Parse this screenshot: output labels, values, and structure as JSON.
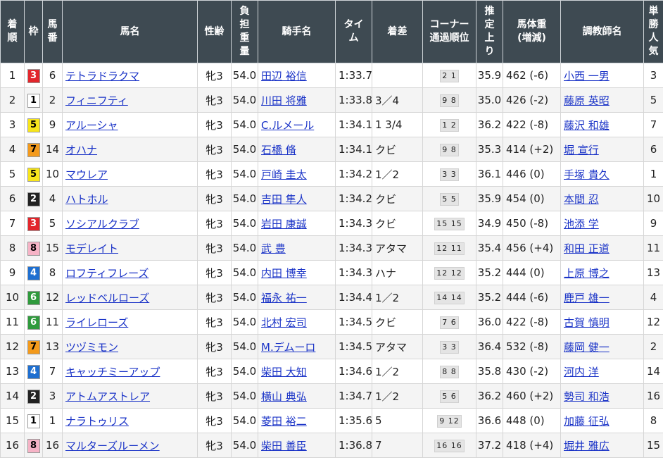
{
  "headers": {
    "rank": [
      "着",
      "順"
    ],
    "waku": [
      "枠"
    ],
    "umaban": [
      "馬",
      "番"
    ],
    "horse": [
      "馬名"
    ],
    "sexage": [
      "性齢"
    ],
    "weight": [
      "負",
      "担",
      "重",
      "量"
    ],
    "jockey": [
      "騎手名"
    ],
    "time": [
      "タイ",
      "ム"
    ],
    "margin": [
      "着差"
    ],
    "corner": [
      "コーナー",
      "通過順位"
    ],
    "last3f": [
      "推",
      "定",
      "上",
      "り"
    ],
    "bodyweight": [
      "馬体重",
      "(増減)"
    ],
    "trainer": [
      "調教師名"
    ],
    "pop": [
      "単",
      "勝",
      "人",
      "気"
    ]
  },
  "waku_colors": {
    "1": {
      "bg": "#ffffff",
      "fg": "#000000"
    },
    "2": {
      "bg": "#222222",
      "fg": "#ffffff"
    },
    "3": {
      "bg": "#e2262c",
      "fg": "#ffffff"
    },
    "4": {
      "bg": "#1e6fd0",
      "fg": "#ffffff"
    },
    "5": {
      "bg": "#f7e51b",
      "fg": "#000000"
    },
    "6": {
      "bg": "#2f9a3c",
      "fg": "#ffffff"
    },
    "7": {
      "bg": "#f39a1c",
      "fg": "#000000"
    },
    "8": {
      "bg": "#f6b3c6",
      "fg": "#000000"
    }
  },
  "rows": [
    {
      "rank": "1",
      "waku": "3",
      "umaban": "6",
      "horse": "テトラドラクマ",
      "sexage": "牝3",
      "weight": "54.0",
      "jockey": "田辺 裕信",
      "time": "1:33.7",
      "margin": "",
      "corner": "2 1",
      "last3f": "35.9",
      "bodyweight": "462 (-6)",
      "trainer": "小西 一男",
      "pop": "3"
    },
    {
      "rank": "2",
      "waku": "1",
      "umaban": "2",
      "horse": "フィニフティ",
      "sexage": "牝3",
      "weight": "54.0",
      "jockey": "川田 将雅",
      "time": "1:33.8",
      "margin": "3／4",
      "corner": "9 8",
      "last3f": "35.0",
      "bodyweight": "426 (-2)",
      "trainer": "藤原 英昭",
      "pop": "5"
    },
    {
      "rank": "3",
      "waku": "5",
      "umaban": "9",
      "horse": "アルーシャ",
      "sexage": "牝3",
      "weight": "54.0",
      "jockey": "C.ルメール",
      "time": "1:34.1",
      "margin": "1 3/4",
      "corner": "1 2",
      "last3f": "36.2",
      "bodyweight": "422 (-8)",
      "trainer": "藤沢 和雄",
      "pop": "7"
    },
    {
      "rank": "4",
      "waku": "7",
      "umaban": "14",
      "horse": "オハナ",
      "sexage": "牝3",
      "weight": "54.0",
      "jockey": "石橋 脩",
      "time": "1:34.1",
      "margin": "クビ",
      "corner": "9 8",
      "last3f": "35.3",
      "bodyweight": "414 (+2)",
      "trainer": "堀 宣行",
      "pop": "6"
    },
    {
      "rank": "5",
      "waku": "5",
      "umaban": "10",
      "horse": "マウレア",
      "sexage": "牝3",
      "weight": "54.0",
      "jockey": "戸崎 圭太",
      "time": "1:34.2",
      "margin": "1／2",
      "corner": "3 3",
      "last3f": "36.1",
      "bodyweight": "446 (0)",
      "trainer": "手塚 貴久",
      "pop": "1"
    },
    {
      "rank": "6",
      "waku": "2",
      "umaban": "4",
      "horse": "ハトホル",
      "sexage": "牝3",
      "weight": "54.0",
      "jockey": "吉田 隼人",
      "time": "1:34.2",
      "margin": "クビ",
      "corner": "5 5",
      "last3f": "35.9",
      "bodyweight": "454 (0)",
      "trainer": "本間 忍",
      "pop": "10"
    },
    {
      "rank": "7",
      "waku": "3",
      "umaban": "5",
      "horse": "ソシアルクラブ",
      "sexage": "牝3",
      "weight": "54.0",
      "jockey": "岩田 康誠",
      "time": "1:34.3",
      "margin": "クビ",
      "corner": "15 15",
      "last3f": "34.9",
      "bodyweight": "450 (-8)",
      "trainer": "池添 学",
      "pop": "9"
    },
    {
      "rank": "8",
      "waku": "8",
      "umaban": "15",
      "horse": "モデレイト",
      "sexage": "牝3",
      "weight": "54.0",
      "jockey": "武 豊",
      "time": "1:34.3",
      "margin": "アタマ",
      "corner": "12 11",
      "last3f": "35.4",
      "bodyweight": "456 (+4)",
      "trainer": "和田 正道",
      "pop": "11"
    },
    {
      "rank": "9",
      "waku": "4",
      "umaban": "8",
      "horse": "ロフティフレーズ",
      "sexage": "牝3",
      "weight": "54.0",
      "jockey": "内田 博幸",
      "time": "1:34.3",
      "margin": "ハナ",
      "corner": "12 12",
      "last3f": "35.2",
      "bodyweight": "444 (0)",
      "trainer": "上原 博之",
      "pop": "13"
    },
    {
      "rank": "10",
      "waku": "6",
      "umaban": "12",
      "horse": "レッドベルローズ",
      "sexage": "牝3",
      "weight": "54.0",
      "jockey": "福永 祐一",
      "time": "1:34.4",
      "margin": "1／2",
      "corner": "14 14",
      "last3f": "35.2",
      "bodyweight": "444 (-6)",
      "trainer": "鹿戸 雄一",
      "pop": "4"
    },
    {
      "rank": "11",
      "waku": "6",
      "umaban": "11",
      "horse": "ライレローズ",
      "sexage": "牝3",
      "weight": "54.0",
      "jockey": "北村 宏司",
      "time": "1:34.5",
      "margin": "クビ",
      "corner": "7 6",
      "last3f": "36.0",
      "bodyweight": "422 (-8)",
      "trainer": "古賀 慎明",
      "pop": "12"
    },
    {
      "rank": "12",
      "waku": "7",
      "umaban": "13",
      "horse": "ツヅミモン",
      "sexage": "牝3",
      "weight": "54.0",
      "jockey": "M.デムーロ",
      "time": "1:34.5",
      "margin": "アタマ",
      "corner": "3 3",
      "last3f": "36.4",
      "bodyweight": "532 (-8)",
      "trainer": "藤岡 健一",
      "pop": "2"
    },
    {
      "rank": "13",
      "waku": "4",
      "umaban": "7",
      "horse": "キャッチミーアップ",
      "sexage": "牝3",
      "weight": "54.0",
      "jockey": "柴田 大知",
      "time": "1:34.6",
      "margin": "1／2",
      "corner": "8 8",
      "last3f": "35.8",
      "bodyweight": "430 (-2)",
      "trainer": "河内 洋",
      "pop": "14"
    },
    {
      "rank": "14",
      "waku": "2",
      "umaban": "3",
      "horse": "アトムアストレア",
      "sexage": "牝3",
      "weight": "54.0",
      "jockey": "横山 典弘",
      "time": "1:34.7",
      "margin": "1／2",
      "corner": "5 6",
      "last3f": "36.2",
      "bodyweight": "460 (+2)",
      "trainer": "勢司 和浩",
      "pop": "16"
    },
    {
      "rank": "15",
      "waku": "1",
      "umaban": "1",
      "horse": "ナラトゥリス",
      "sexage": "牝3",
      "weight": "54.0",
      "jockey": "菱田 裕二",
      "time": "1:35.6",
      "margin": "5",
      "corner": "9 12",
      "last3f": "36.6",
      "bodyweight": "448 (0)",
      "trainer": "加藤 征弘",
      "pop": "8"
    },
    {
      "rank": "16",
      "waku": "8",
      "umaban": "16",
      "horse": "マルターズルーメン",
      "sexage": "牝3",
      "weight": "54.0",
      "jockey": "柴田 善臣",
      "time": "1:36.8",
      "margin": "7",
      "corner": "16 16",
      "last3f": "37.2",
      "bodyweight": "418 (+4)",
      "trainer": "堀井 雅広",
      "pop": "15"
    }
  ]
}
